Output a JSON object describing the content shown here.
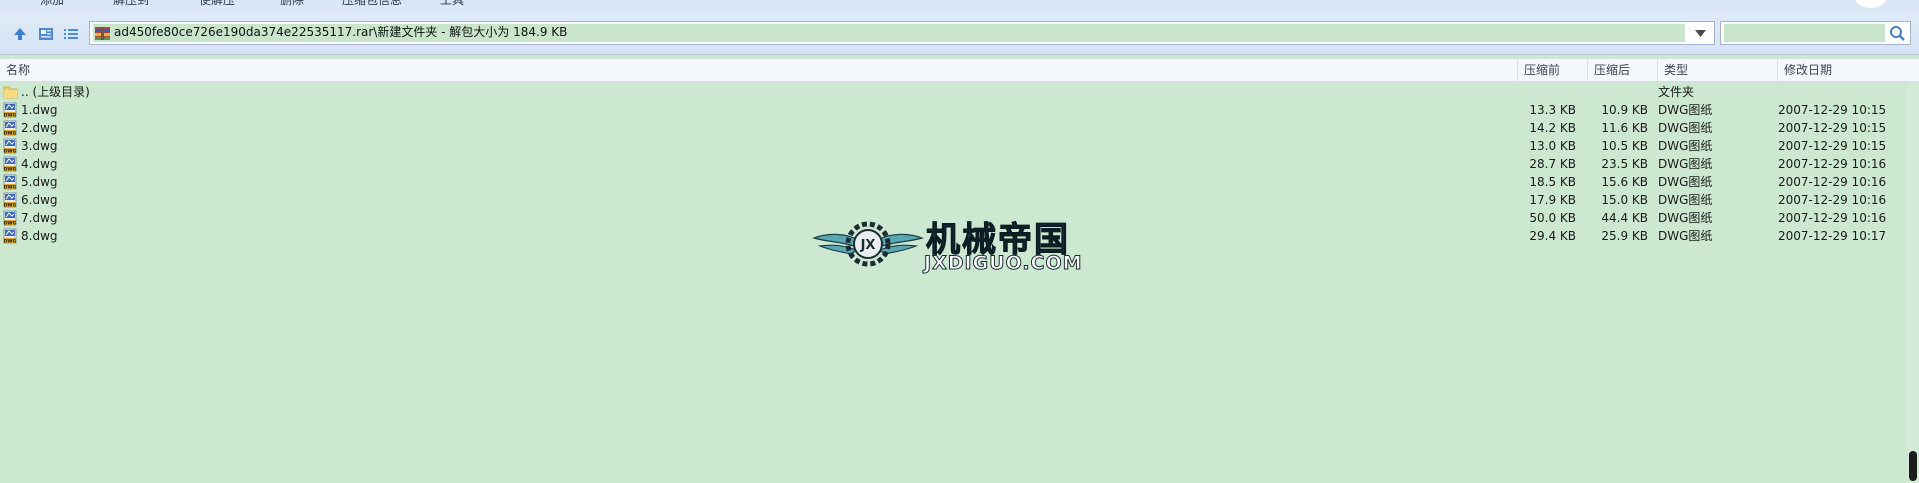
{
  "ribbon": {
    "labels": [
      "添加",
      "解压到",
      "使解压",
      "删除",
      "压缩包信息",
      "工具"
    ]
  },
  "address": {
    "path_text": "ad450fe80ce726e190da374e22535117.rar\\新建文件夹 - 解包大小为 184.9 KB",
    "search_value": ""
  },
  "columns": {
    "name": "名称",
    "packed": "压缩前",
    "size": "压缩后",
    "type": "类型",
    "date": "修改日期"
  },
  "rows": [
    {
      "name": ".. (上级目录)",
      "packed": "",
      "size": "",
      "type": "文件夹",
      "date": "",
      "icon": "folder-icon"
    },
    {
      "name": "1.dwg",
      "packed": "13.3 KB",
      "size": "10.9 KB",
      "type": "DWG图纸",
      "date": "2007-12-29 10:15",
      "icon": "dwg-file-icon"
    },
    {
      "name": "2.dwg",
      "packed": "14.2 KB",
      "size": "11.6 KB",
      "type": "DWG图纸",
      "date": "2007-12-29 10:15",
      "icon": "dwg-file-icon"
    },
    {
      "name": "3.dwg",
      "packed": "13.0 KB",
      "size": "10.5 KB",
      "type": "DWG图纸",
      "date": "2007-12-29 10:15",
      "icon": "dwg-file-icon"
    },
    {
      "name": "4.dwg",
      "packed": "28.7 KB",
      "size": "23.5 KB",
      "type": "DWG图纸",
      "date": "2007-12-29 10:16",
      "icon": "dwg-file-icon"
    },
    {
      "name": "5.dwg",
      "packed": "18.5 KB",
      "size": "15.6 KB",
      "type": "DWG图纸",
      "date": "2007-12-29 10:16",
      "icon": "dwg-file-icon"
    },
    {
      "name": "6.dwg",
      "packed": "17.9 KB",
      "size": "15.0 KB",
      "type": "DWG图纸",
      "date": "2007-12-29 10:16",
      "icon": "dwg-file-icon"
    },
    {
      "name": "7.dwg",
      "packed": "50.0 KB",
      "size": "44.4 KB",
      "type": "DWG图纸",
      "date": "2007-12-29 10:16",
      "icon": "dwg-file-icon"
    },
    {
      "name": "8.dwg",
      "packed": "29.4 KB",
      "size": "25.9 KB",
      "type": "DWG图纸",
      "date": "2007-12-29 10:17",
      "icon": "dwg-file-icon"
    }
  ],
  "watermark": {
    "cn": "机械帝国",
    "en": "JXDIGUO.COM"
  },
  "colors": {
    "background": "#cde8d0",
    "selection": "#c9e6cc",
    "toolbar": "#d6e4f4"
  }
}
